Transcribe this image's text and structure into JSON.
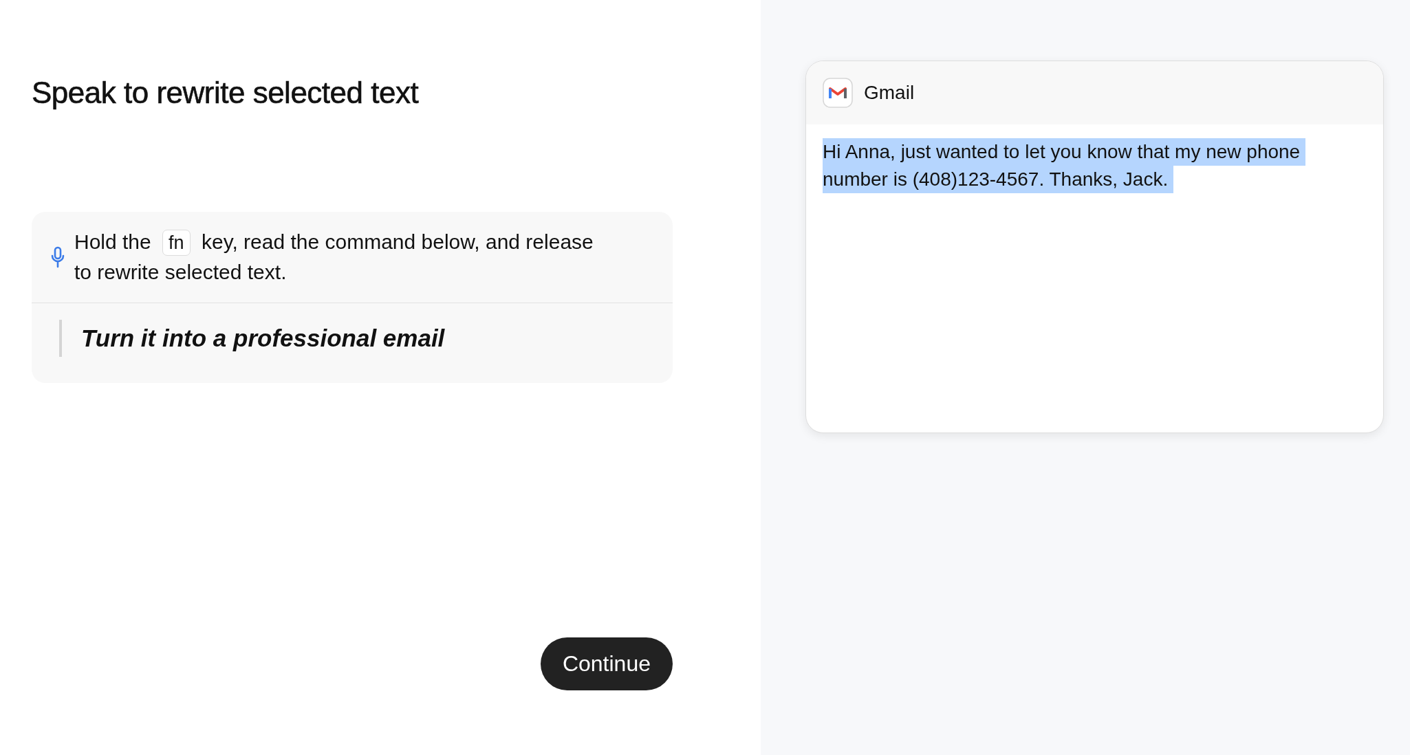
{
  "title": "Speak to rewrite selected text",
  "instruction": {
    "before": "Hold the",
    "key": "fn",
    "after": "key, read the command below, and release",
    "second_line": "to rewrite selected text."
  },
  "command": "Turn it into a professional email",
  "continue_button": "Continue",
  "preview": {
    "app": "Gmail",
    "body_lines": [
      "Hi Anna, just wanted to let you know that my new phone",
      "number is (408)123-4567. Thanks, Jack."
    ],
    "selected": true
  }
}
